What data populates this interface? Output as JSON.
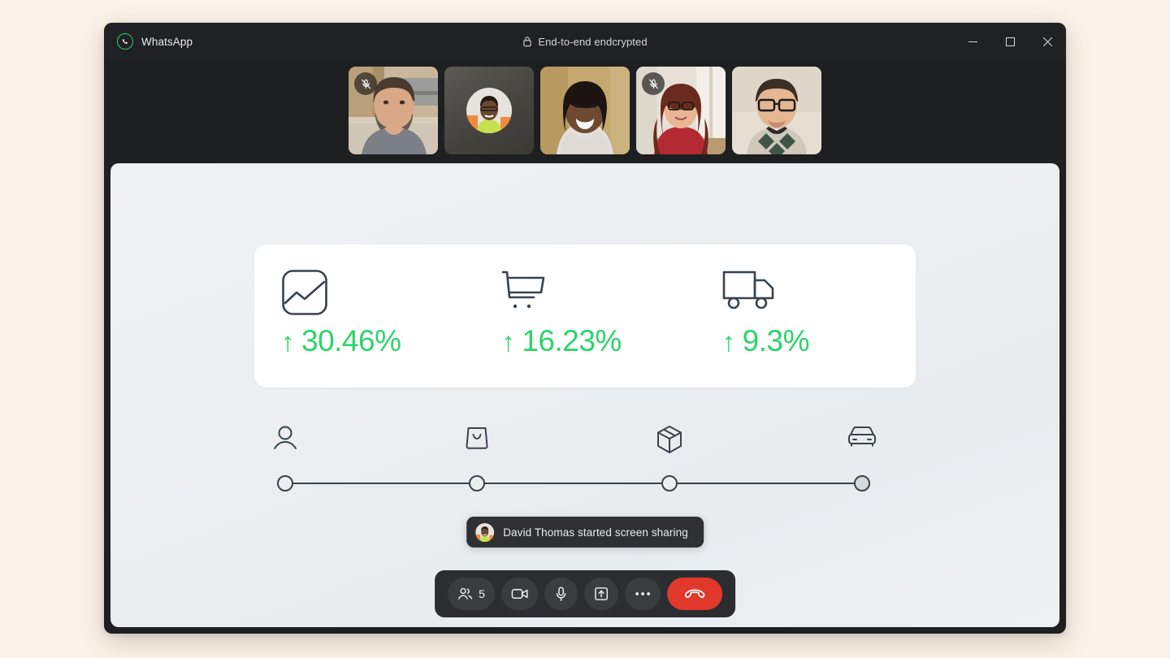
{
  "page": {
    "background_color": "#fbf3e9"
  },
  "window": {
    "app_name": "WhatsApp",
    "logo_icon": "whatsapp-logo-icon",
    "encryption_label": "End-to-end endcrypted",
    "lock_icon": "lock-icon",
    "controls": {
      "minimize": "minimize-icon",
      "maximize": "maximize-icon",
      "close": "close-icon"
    },
    "accent_color": "#25d366",
    "chrome_color": "#202124"
  },
  "filmstrip": {
    "tiles": [
      {
        "id": "tile-1",
        "camera_on": true,
        "muted": true,
        "mute_icon": "mic-off-icon"
      },
      {
        "id": "tile-2",
        "camera_on": false,
        "muted": false,
        "mute_icon": ""
      },
      {
        "id": "tile-3",
        "camera_on": true,
        "muted": false,
        "mute_icon": ""
      },
      {
        "id": "tile-4",
        "camera_on": true,
        "muted": true,
        "mute_icon": "mic-off-icon"
      },
      {
        "id": "tile-5",
        "camera_on": true,
        "muted": false,
        "mute_icon": ""
      }
    ]
  },
  "shared_screen": {
    "stats": [
      {
        "icon": "image-chart-icon",
        "arrow": "↑",
        "value": "30.46%"
      },
      {
        "icon": "shopping-cart-icon",
        "arrow": "↑",
        "value": "16.23%"
      },
      {
        "icon": "delivery-truck-icon",
        "arrow": "↑",
        "value": "9.3%"
      }
    ],
    "stat_color": "#2bd46a",
    "stepper": {
      "steps": [
        {
          "icon": "user-icon",
          "position_pct": 0,
          "filled": false
        },
        {
          "icon": "shopping-bag-icon",
          "position_pct": 33.3,
          "filled": false
        },
        {
          "icon": "package-box-icon",
          "position_pct": 66.6,
          "filled": false
        },
        {
          "icon": "car-icon",
          "position_pct": 100,
          "filled": true
        }
      ],
      "line_color": "#38434f"
    }
  },
  "toast": {
    "avatar_icon": "participant-avatar",
    "message": "David Thomas started screen sharing"
  },
  "controls": {
    "participants": {
      "icon": "people-icon",
      "count": "5"
    },
    "camera": {
      "icon": "video-camera-icon"
    },
    "microphone": {
      "icon": "microphone-icon"
    },
    "share_screen": {
      "icon": "share-screen-icon"
    },
    "more": {
      "icon": "more-ellipsis-icon"
    },
    "end_call": {
      "icon": "end-call-icon",
      "color": "#e0392b"
    }
  }
}
